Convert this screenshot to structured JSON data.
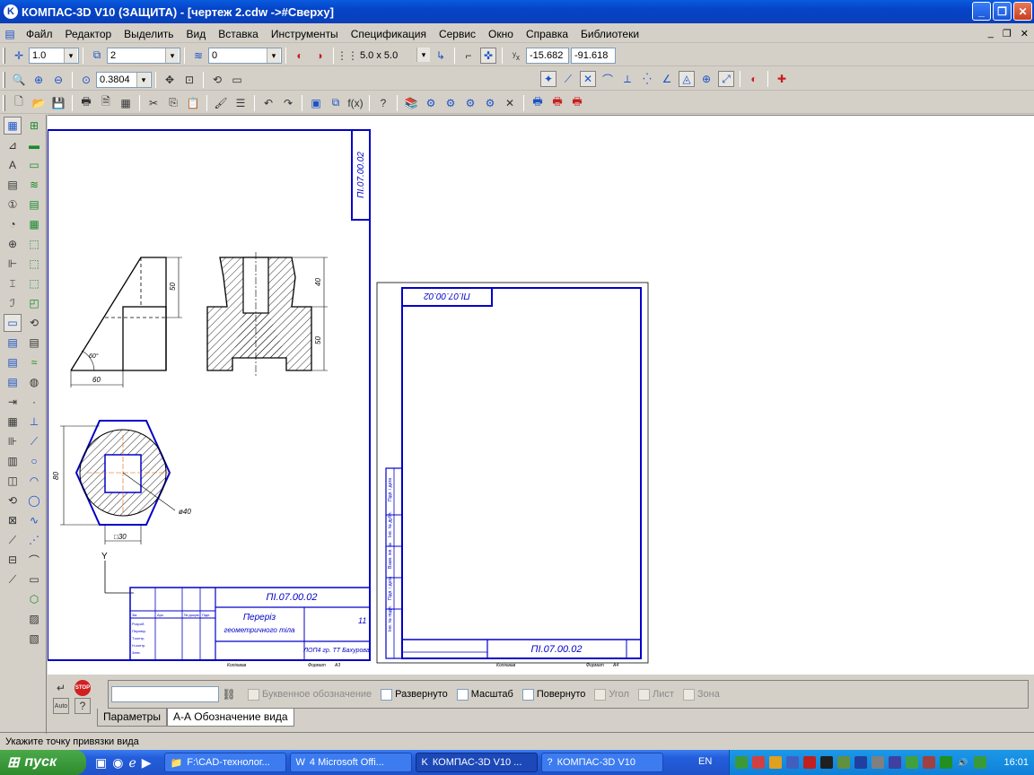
{
  "window": {
    "title": "КОМПАС-3D V10 (ЗАЩИТА) - [чертеж 2.cdw ->#Сверху]",
    "min": "_",
    "max": "❐",
    "close": "✕",
    "app_icon": "K"
  },
  "mdi": {
    "min": "_",
    "restore": "❐",
    "close": "✕"
  },
  "menu": [
    "Файл",
    "Редактор",
    "Выделить",
    "Вид",
    "Вставка",
    "Инструменты",
    "Спецификация",
    "Сервис",
    "Окно",
    "Справка",
    "Библиотеки"
  ],
  "toolbar1": {
    "step": "1.0",
    "layer": "2",
    "style": "0",
    "grid": "5.0 x 5.0",
    "coord_x": "-15.682",
    "coord_y": "-91.618"
  },
  "toolbar2": {
    "zoom": "0.3804"
  },
  "drawing": {
    "code": "ПI.07.00.02",
    "title_line1": "Переріз",
    "title_line2": "геометричного тіла",
    "sheet": "11",
    "group": "ЛОП4 гр. ТТ Бахурова",
    "table_small": [
      "Зм.",
      "Арк.",
      "№ докум.",
      "Підп.",
      "Дата",
      "Розроб.",
      "Перевір.",
      "Т.контр.",
      "Н.контр.",
      "Затв."
    ],
    "format_label": "Формат",
    "format_value": "А3",
    "copied_label": "Копіював",
    "dims": {
      "h50": "50",
      "h40": "40",
      "h50b": "50",
      "w60": "60",
      "ang": "60°",
      "d80": "80",
      "phi40": "ø40",
      "sq30": "□30"
    },
    "axis": "Y",
    "sheet2_code": "ПI.07.00.02",
    "sheet2_side": [
      "Інв. № подл.",
      "Підп. і дата",
      "Взам. інв. №",
      "Інв. № дубл.",
      "Підп. і дата"
    ],
    "sheet2_format": "А4"
  },
  "bottom": {
    "letter": "Буквенное обозначение",
    "rotated": "Развернуто",
    "scale": "Масштаб",
    "rotated2": "Повернуто",
    "angle": "Угол",
    "sheet": "Лист",
    "zone": "Зона",
    "auto": "Auto",
    "stop": "STOP"
  },
  "tabs": {
    "params": "Параметры",
    "view": "А-А Обозначение вида"
  },
  "status": "Укажите точку привязки вида",
  "taskbar": {
    "start": "пуск",
    "items": [
      "F:\\CAD-технолог...",
      "4 Microsoft Offi...",
      "КОМПАС-3D V10 ...",
      "КОМПАС-3D V10"
    ],
    "lang": "EN",
    "clock": "16:01"
  },
  "colors": {
    "frame": "#0000c8",
    "hatch": "#000000",
    "axis": "#e06000"
  }
}
